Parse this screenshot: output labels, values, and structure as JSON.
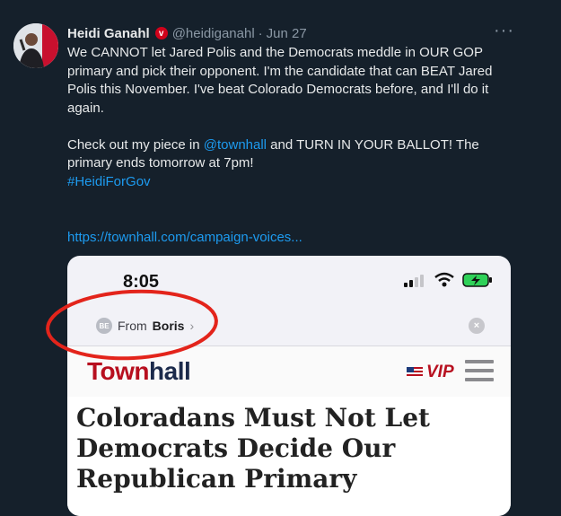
{
  "tweet": {
    "author_name": "Heidi Ganahl",
    "verified_glyph": "v",
    "handle": "@heidiganahl",
    "separator": "·",
    "date": "Jun 27",
    "more_glyph": "···",
    "paragraph1": "We CANNOT let Jared Polis and the Democrats meddle in OUR GOP primary and pick their opponent. I'm the candidate that can BEAT Jared Polis this November. I've beat Colorado Democrats before, and I'll do it again.",
    "p2_prefix": "Check out my piece in ",
    "p2_mention": "@townhall",
    "p2_suffix": " and TURN IN YOUR BALLOT! The primary ends tomorrow at 7pm!",
    "hashtag": "#HeidiForGov",
    "link": "https://townhall.com/campaign-voices..."
  },
  "card": {
    "time": "8:05",
    "from_badge": "BE",
    "from_label": "From",
    "from_name": "Boris",
    "chevron": "›",
    "close_glyph": "×",
    "logo_part1": "Town",
    "logo_part2": "hall",
    "vip_label": "VIP",
    "headline_line1": "Coloradans Must Not Let",
    "headline_line2": "Democrats Decide Our",
    "headline_line3": "Republican Primary"
  },
  "icons": {
    "avatar": "avatar-photo",
    "verified": "verified-badge-icon",
    "more": "more-icon",
    "signal": "cellular-signal-icon",
    "wifi": "wifi-icon",
    "battery": "battery-charging-icon",
    "close": "close-icon",
    "flag": "us-flag-icon",
    "menu": "hamburger-menu-icon"
  },
  "colors": {
    "background": "#15202b",
    "link": "#1d9bf0",
    "townhall_red": "#b70f1f",
    "annotation_ring": "#e3241b"
  }
}
